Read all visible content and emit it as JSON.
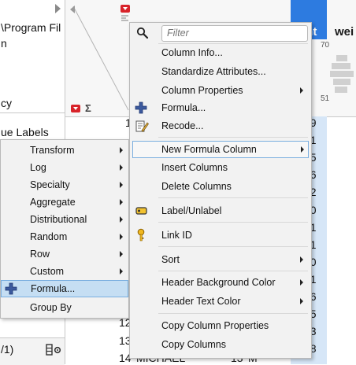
{
  "left_panel": {
    "lines": [
      "\\Program Fil",
      "n",
      "cy",
      "ue Labels"
    ],
    "bottom_text": "/1)"
  },
  "table": {
    "height_header": "ght",
    "weight_header": "wei",
    "height_hist_max": "70",
    "height_hist_min": "51",
    "row_numbers": [
      "1",
      "12",
      "13",
      "14"
    ],
    "height_values": [
      "59",
      "61",
      "55",
      "66",
      "52",
      "60",
      "61",
      "51",
      "60",
      "61",
      "56",
      "65",
      "63",
      "58"
    ],
    "last_row": {
      "name": "MICHAEL",
      "age": "13",
      "sex": "M"
    }
  },
  "submenu": {
    "items": [
      {
        "label": "Transform",
        "has_arrow": true
      },
      {
        "label": "Log",
        "has_arrow": true
      },
      {
        "label": "Specialty",
        "has_arrow": true
      },
      {
        "label": "Aggregate",
        "has_arrow": true
      },
      {
        "label": "Distributional",
        "has_arrow": true
      },
      {
        "label": "Random",
        "has_arrow": true
      },
      {
        "label": "Row",
        "has_arrow": true
      },
      {
        "label": "Custom",
        "has_arrow": true
      },
      {
        "label": "Formula...",
        "has_arrow": false,
        "icon": "formula-plus-icon",
        "selected": true
      },
      {
        "label": "Group By",
        "has_arrow": false
      }
    ]
  },
  "context_menu": {
    "filter_placeholder": "Filter",
    "items": [
      {
        "label": "Column Info...",
        "has_arrow": false
      },
      {
        "label": "Standardize Attributes...",
        "has_arrow": false
      },
      {
        "label": "Column Properties",
        "has_arrow": true
      },
      {
        "label": "Formula...",
        "has_arrow": false,
        "icon": "formula-plus-icon"
      },
      {
        "label": "Recode...",
        "has_arrow": false,
        "icon": "recode-icon"
      },
      {
        "label": "New Formula Column",
        "has_arrow": true,
        "focused": true
      },
      {
        "label": "Insert Columns",
        "has_arrow": false
      },
      {
        "label": "Delete Columns",
        "has_arrow": false
      },
      {
        "label": "Label/Unlabel",
        "has_arrow": false,
        "icon": "label-tag-icon"
      },
      {
        "label": "Link ID",
        "has_arrow": false,
        "icon": "key-icon"
      },
      {
        "label": "Sort",
        "has_arrow": true
      },
      {
        "label": "Header Background Color",
        "has_arrow": true
      },
      {
        "label": "Header Text Color",
        "has_arrow": true
      },
      {
        "label": "Copy Column Properties",
        "has_arrow": false
      },
      {
        "label": "Copy Columns",
        "has_arrow": false
      }
    ]
  },
  "colors": {
    "selected_column": "#2d7be0",
    "selected_column_cells": "#d6e6f7",
    "menu_highlight": "#c5def3",
    "menu_focus_border": "#7aaedf",
    "red_button": "#d8232a"
  }
}
